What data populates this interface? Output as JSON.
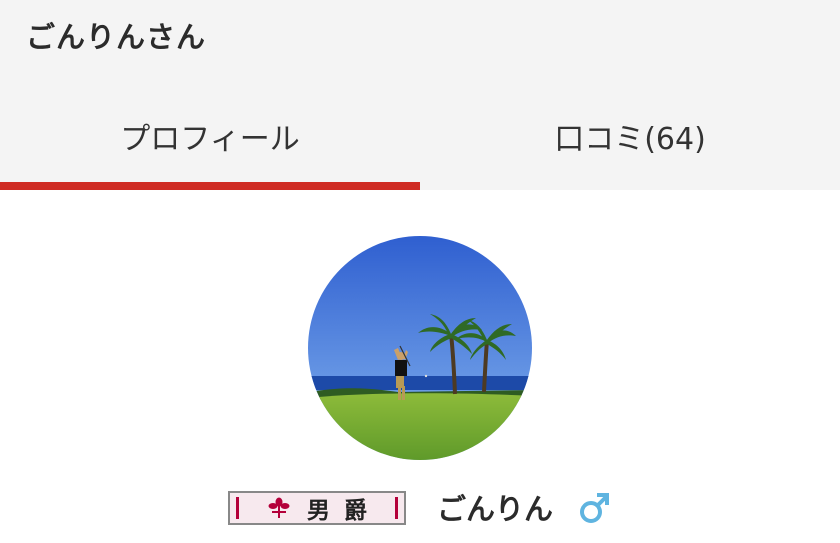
{
  "header": {
    "title": "ごんりんさん"
  },
  "tabs": [
    {
      "label": "プロフィール",
      "active": true
    },
    {
      "label": "口コミ(64)",
      "active": false
    }
  ],
  "colors": {
    "accent": "#cf2b23",
    "header_bg": "#f4f4f4",
    "gender_male": "#5fb4e0",
    "badge_emblem": "#b4003a"
  },
  "profile": {
    "avatar_icon": "profile-photo-golfer",
    "rank_badge": {
      "text": "男爵",
      "icon": "flower-emblem-icon"
    },
    "username": "ごんりん",
    "gender_icon": "male-symbol-icon"
  }
}
